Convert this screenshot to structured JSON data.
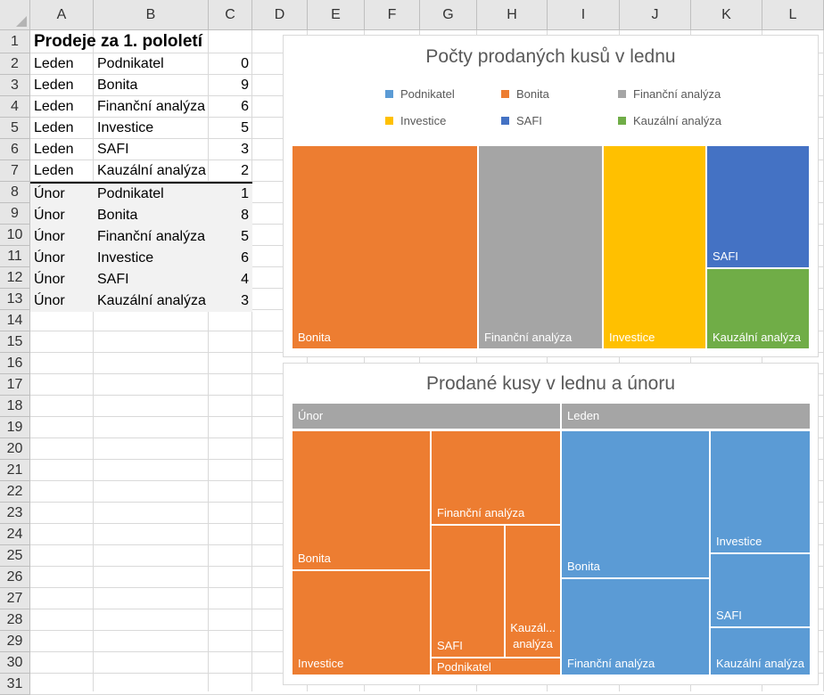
{
  "columns": [
    "A",
    "B",
    "C",
    "D",
    "E",
    "F",
    "G",
    "H",
    "I",
    "J",
    "K",
    "L"
  ],
  "rows": [
    "1",
    "2",
    "3",
    "4",
    "5",
    "6",
    "7",
    "8",
    "9",
    "10",
    "11",
    "12",
    "13",
    "14",
    "15",
    "16",
    "17",
    "18",
    "19",
    "20",
    "21",
    "22",
    "23",
    "24",
    "25",
    "26",
    "27",
    "28",
    "29",
    "30",
    "31"
  ],
  "sheet": {
    "title": "Prodeje za 1. pololetí",
    "table": [
      [
        "Leden",
        "Podnikatel",
        "0"
      ],
      [
        "Leden",
        "Bonita",
        "9"
      ],
      [
        "Leden",
        "Finanční analýza",
        "6"
      ],
      [
        "Leden",
        "Investice",
        "5"
      ],
      [
        "Leden",
        "SAFI",
        "3"
      ],
      [
        "Leden",
        "Kauzální analýza",
        "2"
      ],
      [
        "Únor",
        "Podnikatel",
        "1"
      ],
      [
        "Únor",
        "Bonita",
        "8"
      ],
      [
        "Únor",
        "Finanční analýza",
        "5"
      ],
      [
        "Únor",
        "Investice",
        "6"
      ],
      [
        "Únor",
        "SAFI",
        "4"
      ],
      [
        "Únor",
        "Kauzální analýza",
        "3"
      ]
    ]
  },
  "chart1": {
    "title": "Počty prodaných kusů v lednu",
    "legend": [
      {
        "name": "Podnikatel",
        "color": "#5b9bd5"
      },
      {
        "name": "Bonita",
        "color": "#ed7d31"
      },
      {
        "name": "Finanční analýza",
        "color": "#a5a5a5"
      },
      {
        "name": "Investice",
        "color": "#ffc000"
      },
      {
        "name": "SAFI",
        "color": "#4472c4"
      },
      {
        "name": "Kauzální analýza",
        "color": "#70ad47"
      }
    ],
    "tiles": [
      "Bonita",
      "Finanční analýza",
      "Investice",
      "SAFI",
      "Kauzální analýza"
    ]
  },
  "chart2": {
    "title": "Prodané kusy v lednu a únoru",
    "groups": [
      "Únor",
      "Leden"
    ],
    "unor_tiles": [
      "Bonita",
      "Investice",
      "Finanční analýza",
      "SAFI",
      "Kauzál... analýza",
      "Podnikatel"
    ],
    "leden_tiles": [
      "Bonita",
      "Investice",
      "SAFI",
      "Finanční analýza",
      "Kauzální analýza"
    ]
  },
  "colors": {
    "orange": "#ed7d31",
    "gray": "#a5a5a5",
    "yellow": "#ffc000",
    "blue": "#4472c4",
    "green": "#70ad47",
    "lightblue": "#5b9bd5"
  },
  "chart_data": [
    {
      "type": "treemap",
      "title": "Počty prodaných kusů v lednu",
      "categories": [
        "Podnikatel",
        "Bonita",
        "Finanční analýza",
        "Investice",
        "SAFI",
        "Kauzální analýza"
      ],
      "values": [
        0,
        9,
        6,
        5,
        3,
        2
      ]
    },
    {
      "type": "treemap",
      "title": "Prodané kusy v lednu a únoru",
      "groups": [
        {
          "name": "Únor",
          "categories": [
            "Podnikatel",
            "Bonita",
            "Finanční analýza",
            "Investice",
            "SAFI",
            "Kauzální analýza"
          ],
          "values": [
            1,
            8,
            5,
            6,
            4,
            3
          ]
        },
        {
          "name": "Leden",
          "categories": [
            "Podnikatel",
            "Bonita",
            "Finanční analýza",
            "Investice",
            "SAFI",
            "Kauzální analýza"
          ],
          "values": [
            0,
            9,
            6,
            5,
            3,
            2
          ]
        }
      ]
    }
  ]
}
